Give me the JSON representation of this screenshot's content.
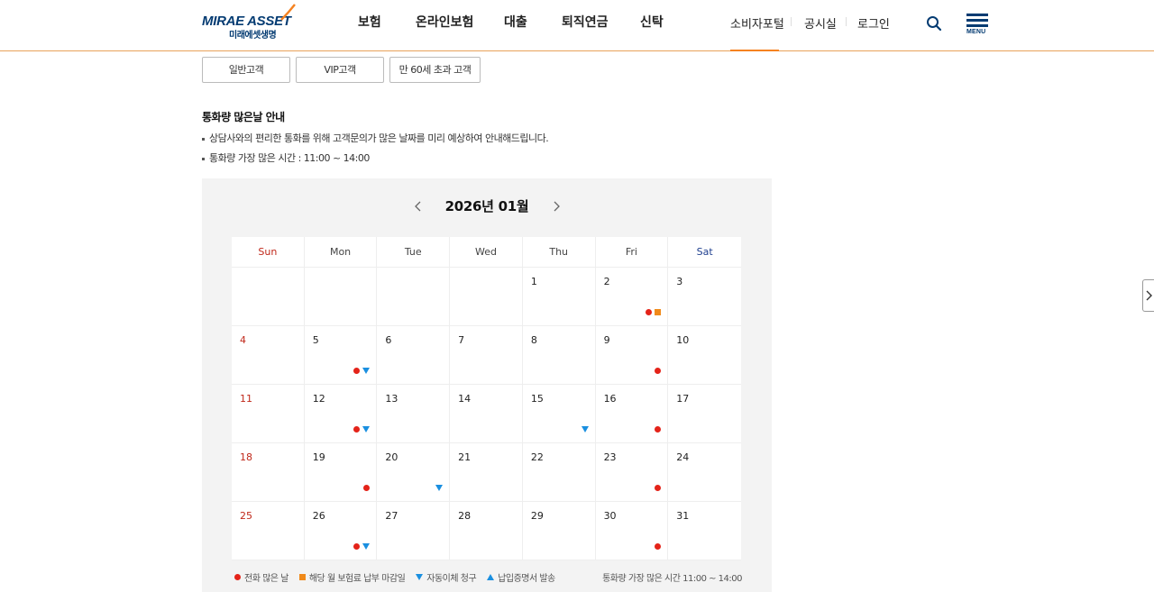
{
  "header": {
    "logo_en": "MIRAE ASSET",
    "logo_ko": "미래에셋생명",
    "nav": [
      "보험",
      "온라인보험",
      "대출",
      "퇴직연금",
      "신탁"
    ],
    "util": [
      "소비자포털",
      "공시실",
      "로그인"
    ],
    "menu_label": "MENU",
    "accent_color": "#f58220",
    "brand_color": "#043b72"
  },
  "tabs": [
    "일반고객",
    "VIP고객",
    "만 60세 초과 고객"
  ],
  "info": {
    "title": "통화량 많은날 안내",
    "lines": [
      "상담사와의 편리한 통화를 위해 고객문의가 많은 날짜를 미리 예상하여 안내해드립니다.",
      "통화량 가장 많은 시간 : 11:00 ~ 14:00"
    ]
  },
  "calendar": {
    "month_title": "2026년 01월",
    "weekdays": [
      "Sun",
      "Mon",
      "Tue",
      "Wed",
      "Thu",
      "Fri",
      "Sat"
    ],
    "days": [
      {
        "d": "",
        "m": []
      },
      {
        "d": "",
        "m": []
      },
      {
        "d": "",
        "m": []
      },
      {
        "d": "",
        "m": []
      },
      {
        "d": "1",
        "m": []
      },
      {
        "d": "2",
        "m": [
          "dot",
          "sq"
        ]
      },
      {
        "d": "3",
        "m": []
      },
      {
        "d": "4",
        "m": []
      },
      {
        "d": "5",
        "m": [
          "dot",
          "down"
        ]
      },
      {
        "d": "6",
        "m": []
      },
      {
        "d": "7",
        "m": []
      },
      {
        "d": "8",
        "m": []
      },
      {
        "d": "9",
        "m": [
          "dot"
        ]
      },
      {
        "d": "10",
        "m": []
      },
      {
        "d": "11",
        "m": []
      },
      {
        "d": "12",
        "m": [
          "dot",
          "down"
        ]
      },
      {
        "d": "13",
        "m": []
      },
      {
        "d": "14",
        "m": []
      },
      {
        "d": "15",
        "m": [
          "down"
        ]
      },
      {
        "d": "16",
        "m": [
          "dot"
        ]
      },
      {
        "d": "17",
        "m": []
      },
      {
        "d": "18",
        "m": []
      },
      {
        "d": "19",
        "m": [
          "dot"
        ]
      },
      {
        "d": "20",
        "m": [
          "down"
        ]
      },
      {
        "d": "21",
        "m": []
      },
      {
        "d": "22",
        "m": []
      },
      {
        "d": "23",
        "m": [
          "dot"
        ]
      },
      {
        "d": "24",
        "m": []
      },
      {
        "d": "25",
        "m": []
      },
      {
        "d": "26",
        "m": [
          "dot",
          "down"
        ]
      },
      {
        "d": "27",
        "m": []
      },
      {
        "d": "28",
        "m": []
      },
      {
        "d": "29",
        "m": []
      },
      {
        "d": "30",
        "m": [
          "dot"
        ]
      },
      {
        "d": "31",
        "m": []
      }
    ],
    "sunday_color": "#c0281a",
    "saturday_color": "#1f3f8f"
  },
  "legend": {
    "items": [
      {
        "shape": "dot",
        "label": "전화 많은 날",
        "color": "#e42319"
      },
      {
        "shape": "sq",
        "label": "해당 월 보험료 납부 마감일",
        "color": "#f08a1a"
      },
      {
        "shape": "down",
        "label": "자동이체 청구",
        "color": "#1a8fe0"
      },
      {
        "shape": "up",
        "label": "납입증명서 발송",
        "color": "#1a8fe0"
      }
    ],
    "note": "통화량 가장 많은 시간 11:00 ~ 14:00"
  }
}
